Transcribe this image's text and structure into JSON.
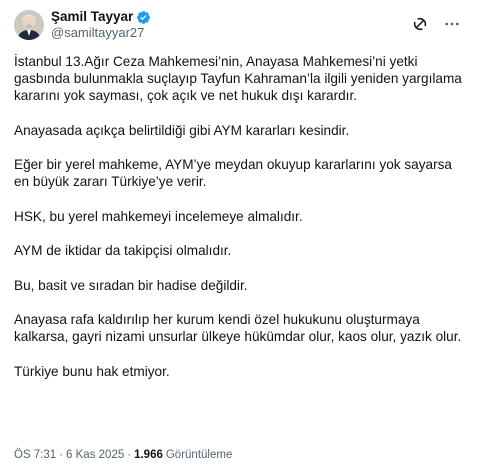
{
  "author": {
    "display_name": "Şamil Tayyar",
    "handle": "@samiltayyar27",
    "verified_icon": "verified-badge-icon",
    "brand_color": "#1d9bf0"
  },
  "header_actions": {
    "grok_icon": "grok-icon",
    "more_icon": "more-icon"
  },
  "tweet": {
    "paragraphs": [
      "İstanbul 13.Ağır Ceza Mahkemesi’nin, Anayasa Mahkemesi’ni yetki gasbında bulunmakla suçlayıp Tayfun Kahraman’la ilgili yeniden yargılama kararını yok sayması, çok açık ve net hukuk dışı karardır.",
      "Anayasada açıkça belirtildiği gibi AYM kararları kesindir.",
      "Eğer bir yerel mahkeme, AYM’ye meydan okuyup kararlarını yok sayarsa en büyük zararı Türkiye’ye verir.",
      "HSK, bu yerel mahkemeyi incelemeye almalıdır.",
      "AYM de iktidar da takipçisi olmalıdır.",
      "Bu, basit ve sıradan bir hadise değildir.",
      "Anayasa rafa kaldırılıp her kurum kendi özel hukukunu oluşturmaya kalkarsa, gayri nizami unsurlar ülkeye hükümdar olur, kaos olur, yazık olur.",
      "Türkiye bunu hak etmiyor."
    ]
  },
  "meta": {
    "time": "ÖS 7:31",
    "separator": "·",
    "date": "6 Kas 2025",
    "views_count": "1.966",
    "views_label": "Görüntüleme"
  }
}
